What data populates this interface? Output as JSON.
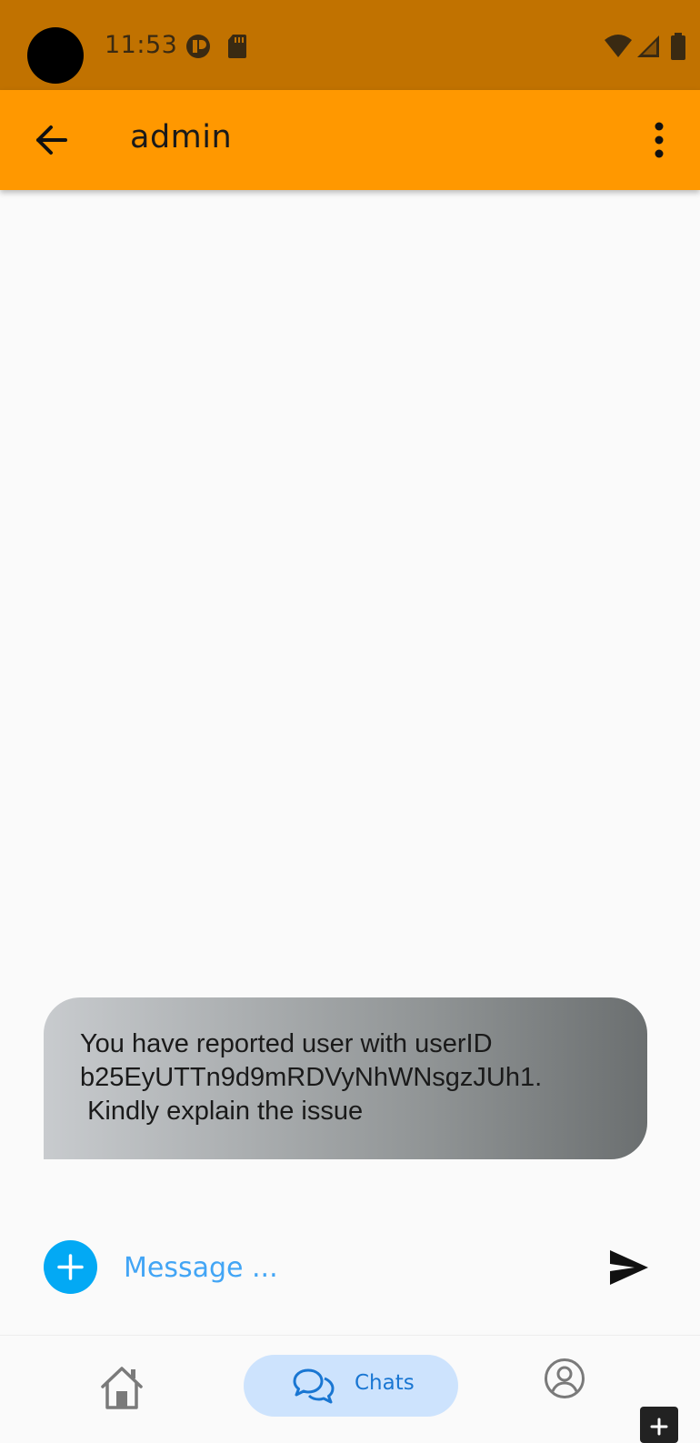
{
  "status_bar": {
    "time": "11:53",
    "icons": [
      "notification-app-icon",
      "sd-card-icon",
      "wifi-icon",
      "cellular-signal-icon",
      "battery-icon"
    ]
  },
  "app_bar": {
    "title": "admin",
    "back_icon": "arrow-left-icon",
    "menu_icon": "more-vertical-icon",
    "color": "#ff9800"
  },
  "messages": [
    {
      "text": "You have reported user with userID\nb25EyUTTn9d9mRDVyNhWNsgzJUh1.\n Kindly explain the issue",
      "direction": "incoming"
    }
  ],
  "composer": {
    "placeholder": "Message ...",
    "value": "",
    "attach_icon": "plus-icon",
    "send_icon": "send-icon"
  },
  "bottom_nav": {
    "items": [
      {
        "id": "home",
        "icon": "home-icon",
        "label": "",
        "active": false
      },
      {
        "id": "chats",
        "icon": "chat-bubbles-icon",
        "label": "Chats",
        "active": true
      },
      {
        "id": "profile",
        "icon": "account-circle-icon",
        "label": "",
        "active": false
      }
    ],
    "active_color": "#1976d2",
    "active_bg": "#cde3fd"
  }
}
